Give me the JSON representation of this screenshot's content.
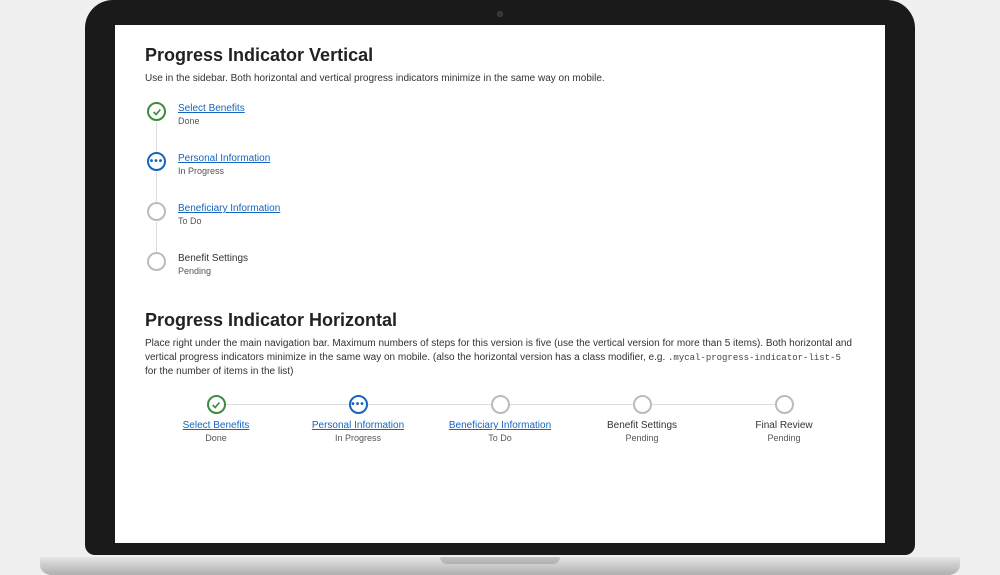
{
  "vertical": {
    "title": "Progress Indicator Vertical",
    "description": "Use in the sidebar. Both horizontal and vertical progress indicators minimize in the same way on mobile.",
    "steps": [
      {
        "label": "Select Benefits",
        "status": "Done",
        "state": "done",
        "link": true
      },
      {
        "label": "Personal Information",
        "status": "In Progress",
        "state": "progress",
        "link": true
      },
      {
        "label": "Beneficiary Information",
        "status": "To Do",
        "state": "todo",
        "link": true
      },
      {
        "label": "Benefit Settings",
        "status": "Pending",
        "state": "pending",
        "link": false
      }
    ]
  },
  "horizontal": {
    "title": "Progress Indicator Horizontal",
    "description_pre": "Place right under the main navigation bar. Maximum numbers of steps for this version is five (use the vertical version for more than 5 items). Both horizontal and vertical progress indicators minimize in the same way on mobile. (also the horizontal version has a class modifier, e.g. ",
    "description_code": ".mycal-progress-indicator-list-5",
    "description_post": " for the number of items in the list)",
    "steps": [
      {
        "label": "Select Benefits",
        "status": "Done",
        "state": "done",
        "link": true
      },
      {
        "label": "Personal Information",
        "status": "In Progress",
        "state": "progress",
        "link": true
      },
      {
        "label": "Beneficiary Information",
        "status": "To Do",
        "state": "todo",
        "link": true
      },
      {
        "label": "Benefit Settings",
        "status": "Pending",
        "state": "pending",
        "link": false
      },
      {
        "label": "Final Review",
        "status": "Pending",
        "state": "pending",
        "link": false
      }
    ]
  }
}
